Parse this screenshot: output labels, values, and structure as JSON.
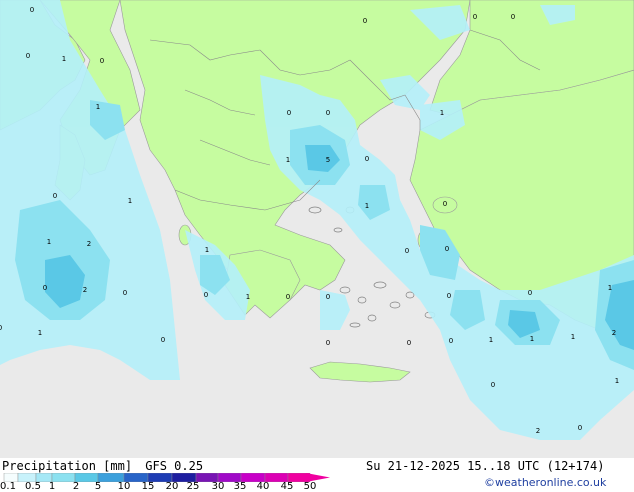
{
  "title": "Precipitation [mm]",
  "model": "GFS 0.25",
  "valid_time": "Su 21-12-2025 15..18 UTC (12+174)",
  "credit": "©weatheronline.co.uk",
  "colors": {
    "sea": "#eaeaea",
    "land": "#c6fca0",
    "border": "#808080",
    "precip_light": "#b4f0fa",
    "precip_mid": "#8ce1f0",
    "precip_heavy": "#5ac8e6"
  },
  "legend": {
    "ticks": [
      "0.1",
      "0.5",
      "1",
      "2",
      "5",
      "10",
      "15",
      "20",
      "25",
      "30",
      "35",
      "40",
      "45",
      "50"
    ],
    "colors": [
      "#f5fdfe",
      "#c8f2fb",
      "#a5e8f6",
      "#8ce1f0",
      "#5ac8e6",
      "#3ca0dc",
      "#2864c8",
      "#1e3cb4",
      "#1e1ea0",
      "#7814b4",
      "#a00ac8",
      "#c800c8",
      "#dc00b4",
      "#f000a0"
    ]
  },
  "map_labels": [
    "0",
    "0",
    "1",
    "0",
    "0",
    "0",
    "0",
    "0",
    "1",
    "1",
    "0",
    "0",
    "1",
    "0",
    "1",
    "1",
    "5",
    "0",
    "1",
    "0",
    "0",
    "1",
    "2",
    "0",
    "1",
    "1",
    "0",
    "0",
    "0",
    "2",
    "0",
    "2",
    "0",
    "1",
    "1",
    "0",
    "1",
    "0",
    "0",
    "1",
    "0",
    "0",
    "1",
    "0",
    "2",
    "0",
    "0",
    "0",
    "1",
    "2",
    "0"
  ]
}
